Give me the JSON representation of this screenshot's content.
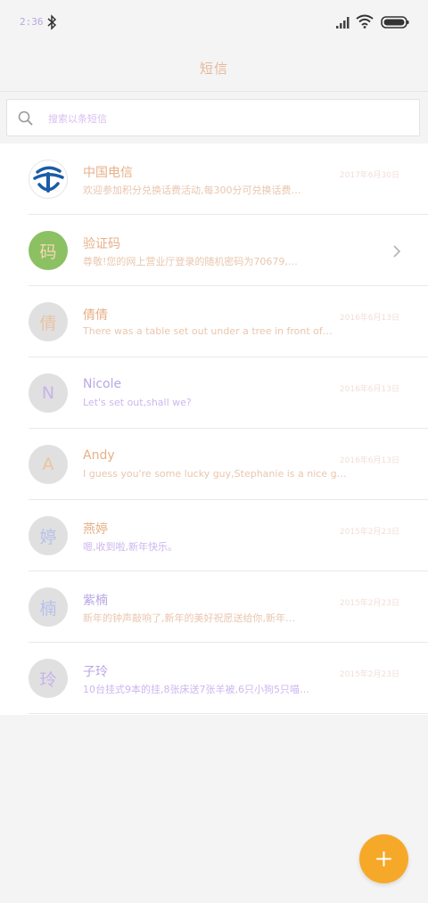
{
  "status_bar": {
    "time": "2:36",
    "icons": [
      "bluetooth-icon",
      "signal-icon",
      "wifi-icon",
      "battery-icon"
    ]
  },
  "header": {
    "title": "短信"
  },
  "search": {
    "placeholder": "搜索以条短信",
    "icon": "search-icon"
  },
  "conversations": [
    {
      "avatar": "logo",
      "avatar_icon": "china-telecom-logo-icon",
      "name": "中国电信",
      "date": "2017年6月30日",
      "snippet": "欢迎参加积分兑换话费活动,每300分可兑换话费…"
    },
    {
      "avatar": "码",
      "name": "验证码",
      "date": "",
      "snippet": "尊敬!您的网上营业厅登录的随机密码为70679,…",
      "has_chevron": true
    },
    {
      "avatar": "倩",
      "name": "倩倩",
      "date": "2016年6月13日",
      "snippet": "There was a table set out under a tree in front of…"
    },
    {
      "avatar": "N",
      "name": "Nicole",
      "date": "2016年6月13日",
      "snippet": "Let's set out,shall we?"
    },
    {
      "avatar": "A",
      "name": "Andy",
      "date": "2016年6月13日",
      "snippet": "I guess you're some lucky guy,Stephanie is a nice g…"
    },
    {
      "avatar": "婷",
      "name": "燕婷",
      "date": "2015年2月23日",
      "snippet": "嗯,收到啦,新年快乐。"
    },
    {
      "avatar": "楠",
      "name": "紫楠",
      "date": "2015年2月23日",
      "snippet": "新年的钟声敲响了,新年的美好祝愿送给你,新年…"
    },
    {
      "avatar": "玲",
      "name": "子玲",
      "date": "2015年2月23日",
      "snippet": "10台挂式9本的挂,8张床送7张羊被,6只小狗5只喵…"
    }
  ],
  "fab": {
    "label": "+",
    "icon": "plus-icon"
  },
  "colors": {
    "accent": "#f6a928",
    "avatar_green": "#8bc163",
    "avatar_grey": "#e0e0e0",
    "telecom_blue": "#1a5ca8"
  }
}
